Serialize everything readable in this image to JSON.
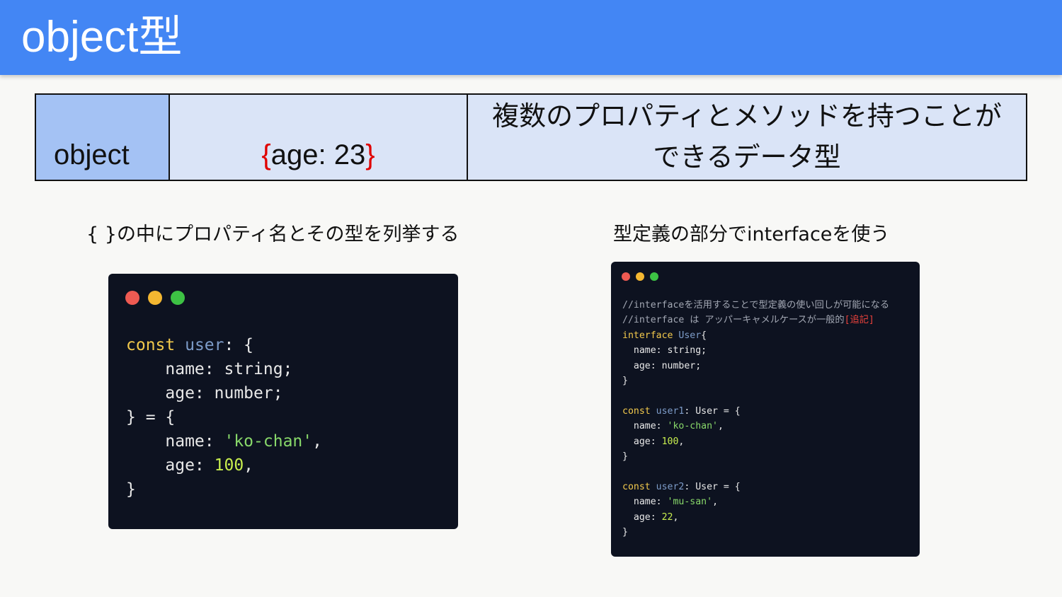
{
  "slide": {
    "title": "object型"
  },
  "summary_table": {
    "type_name": "object",
    "example_open": "{",
    "example_body": "age: 23",
    "example_close": "}",
    "description_line1": "複数のプロパティとメソッドを持つことが",
    "description_line2": "できるデータ型"
  },
  "captions": {
    "left": "{ }の中にプロパティ名とその型を列挙する",
    "right": "型定義の部分でinterfaceを使う"
  },
  "window_dots": {
    "colors": [
      "#ee5a52",
      "#f4b731",
      "#3dc244"
    ]
  },
  "code_left": {
    "lines": [
      [
        {
          "t": "const ",
          "c": "kw"
        },
        {
          "t": "user",
          "c": "ident"
        },
        {
          "t": ": {",
          "c": "plain"
        }
      ],
      [
        {
          "t": "    name: string;",
          "c": "plain"
        }
      ],
      [
        {
          "t": "    age: number;",
          "c": "plain"
        }
      ],
      [
        {
          "t": "} = {",
          "c": "plain"
        }
      ],
      [
        {
          "t": "    name: ",
          "c": "plain"
        },
        {
          "t": "'ko-chan'",
          "c": "str"
        },
        {
          "t": ",",
          "c": "plain"
        }
      ],
      [
        {
          "t": "    age: ",
          "c": "plain"
        },
        {
          "t": "100",
          "c": "num"
        },
        {
          "t": ",",
          "c": "plain"
        }
      ],
      [
        {
          "t": "}",
          "c": "plain"
        }
      ]
    ]
  },
  "code_right": {
    "lines": [
      [
        {
          "t": "//interfaceを活用することで型定義の使い回しが可能になる",
          "c": "cmt"
        }
      ],
      [
        {
          "t": "//interface は アッパーキャメルケースが一般的",
          "c": "cmt"
        },
        {
          "t": "[追記]",
          "c": "warn"
        }
      ],
      [
        {
          "t": "interface ",
          "c": "kw"
        },
        {
          "t": "User",
          "c": "ident"
        },
        {
          "t": "{",
          "c": "plain"
        }
      ],
      [
        {
          "t": "  name: string;",
          "c": "plain"
        }
      ],
      [
        {
          "t": "  age: number;",
          "c": "plain"
        }
      ],
      [
        {
          "t": "}",
          "c": "plain"
        }
      ],
      [
        {
          "t": "",
          "c": "plain"
        }
      ],
      [
        {
          "t": "const ",
          "c": "kw"
        },
        {
          "t": "user1",
          "c": "ident"
        },
        {
          "t": ": User = {",
          "c": "plain"
        }
      ],
      [
        {
          "t": "  name: ",
          "c": "plain"
        },
        {
          "t": "'ko-chan'",
          "c": "str"
        },
        {
          "t": ",",
          "c": "plain"
        }
      ],
      [
        {
          "t": "  age: ",
          "c": "plain"
        },
        {
          "t": "100",
          "c": "num"
        },
        {
          "t": ",",
          "c": "plain"
        }
      ],
      [
        {
          "t": "}",
          "c": "plain"
        }
      ],
      [
        {
          "t": "",
          "c": "plain"
        }
      ],
      [
        {
          "t": "const ",
          "c": "kw"
        },
        {
          "t": "user2",
          "c": "ident"
        },
        {
          "t": ": User = {",
          "c": "plain"
        }
      ],
      [
        {
          "t": "  name: ",
          "c": "plain"
        },
        {
          "t": "'mu-san'",
          "c": "str"
        },
        {
          "t": ",",
          "c": "plain"
        }
      ],
      [
        {
          "t": "  age: ",
          "c": "plain"
        },
        {
          "t": "22",
          "c": "num"
        },
        {
          "t": ",",
          "c": "plain"
        }
      ],
      [
        {
          "t": "}",
          "c": "plain"
        }
      ]
    ]
  }
}
